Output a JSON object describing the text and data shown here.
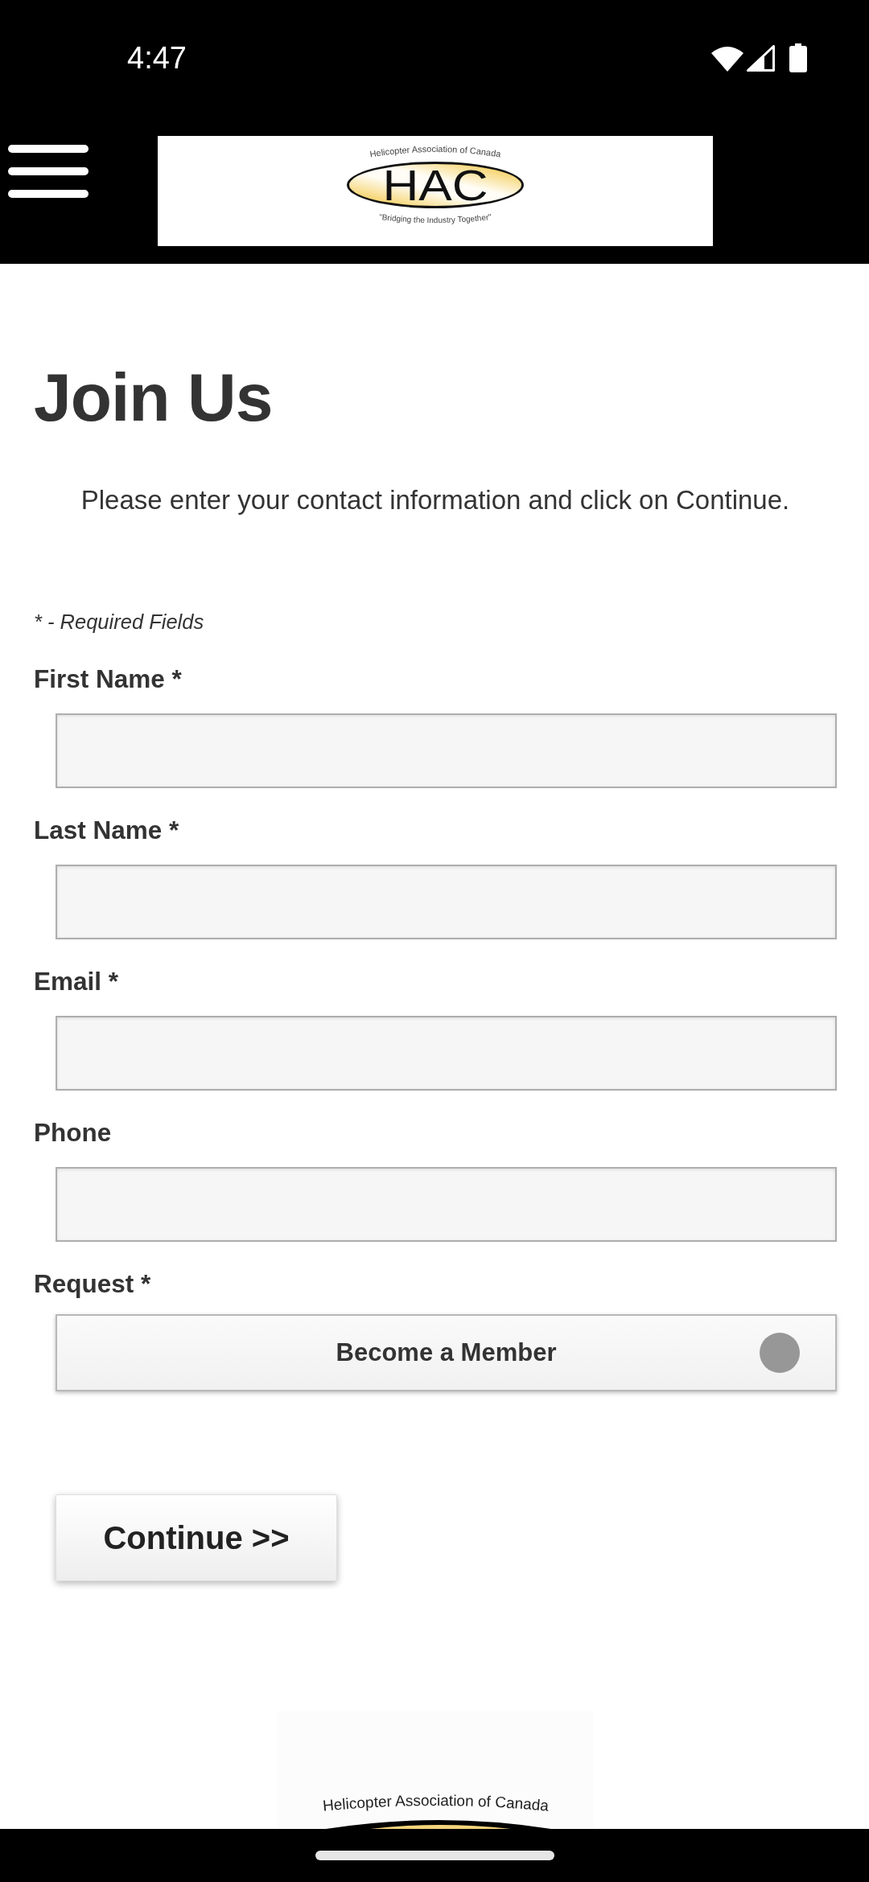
{
  "status_bar": {
    "time": "4:47"
  },
  "header": {
    "logo": {
      "arc_text": "Helicopter Association of Canada",
      "text": "HAC",
      "tagline": "\"Bridging the Industry Together\""
    }
  },
  "page": {
    "title": "Join Us",
    "intro": "Please enter your contact information and click on Continue.",
    "required_note": "* - Required Fields"
  },
  "form": {
    "fields": [
      {
        "kind": "text",
        "label": "First Name *"
      },
      {
        "kind": "text",
        "label": "Last Name *"
      },
      {
        "kind": "text",
        "label": "Email *"
      },
      {
        "kind": "text",
        "label": "Phone"
      },
      {
        "kind": "select",
        "label": "Request *",
        "value": "Become a Member"
      }
    ],
    "submit": "Continue >>"
  },
  "footer_logo": {
    "arc_text": "Helicopter Association of Canada"
  }
}
